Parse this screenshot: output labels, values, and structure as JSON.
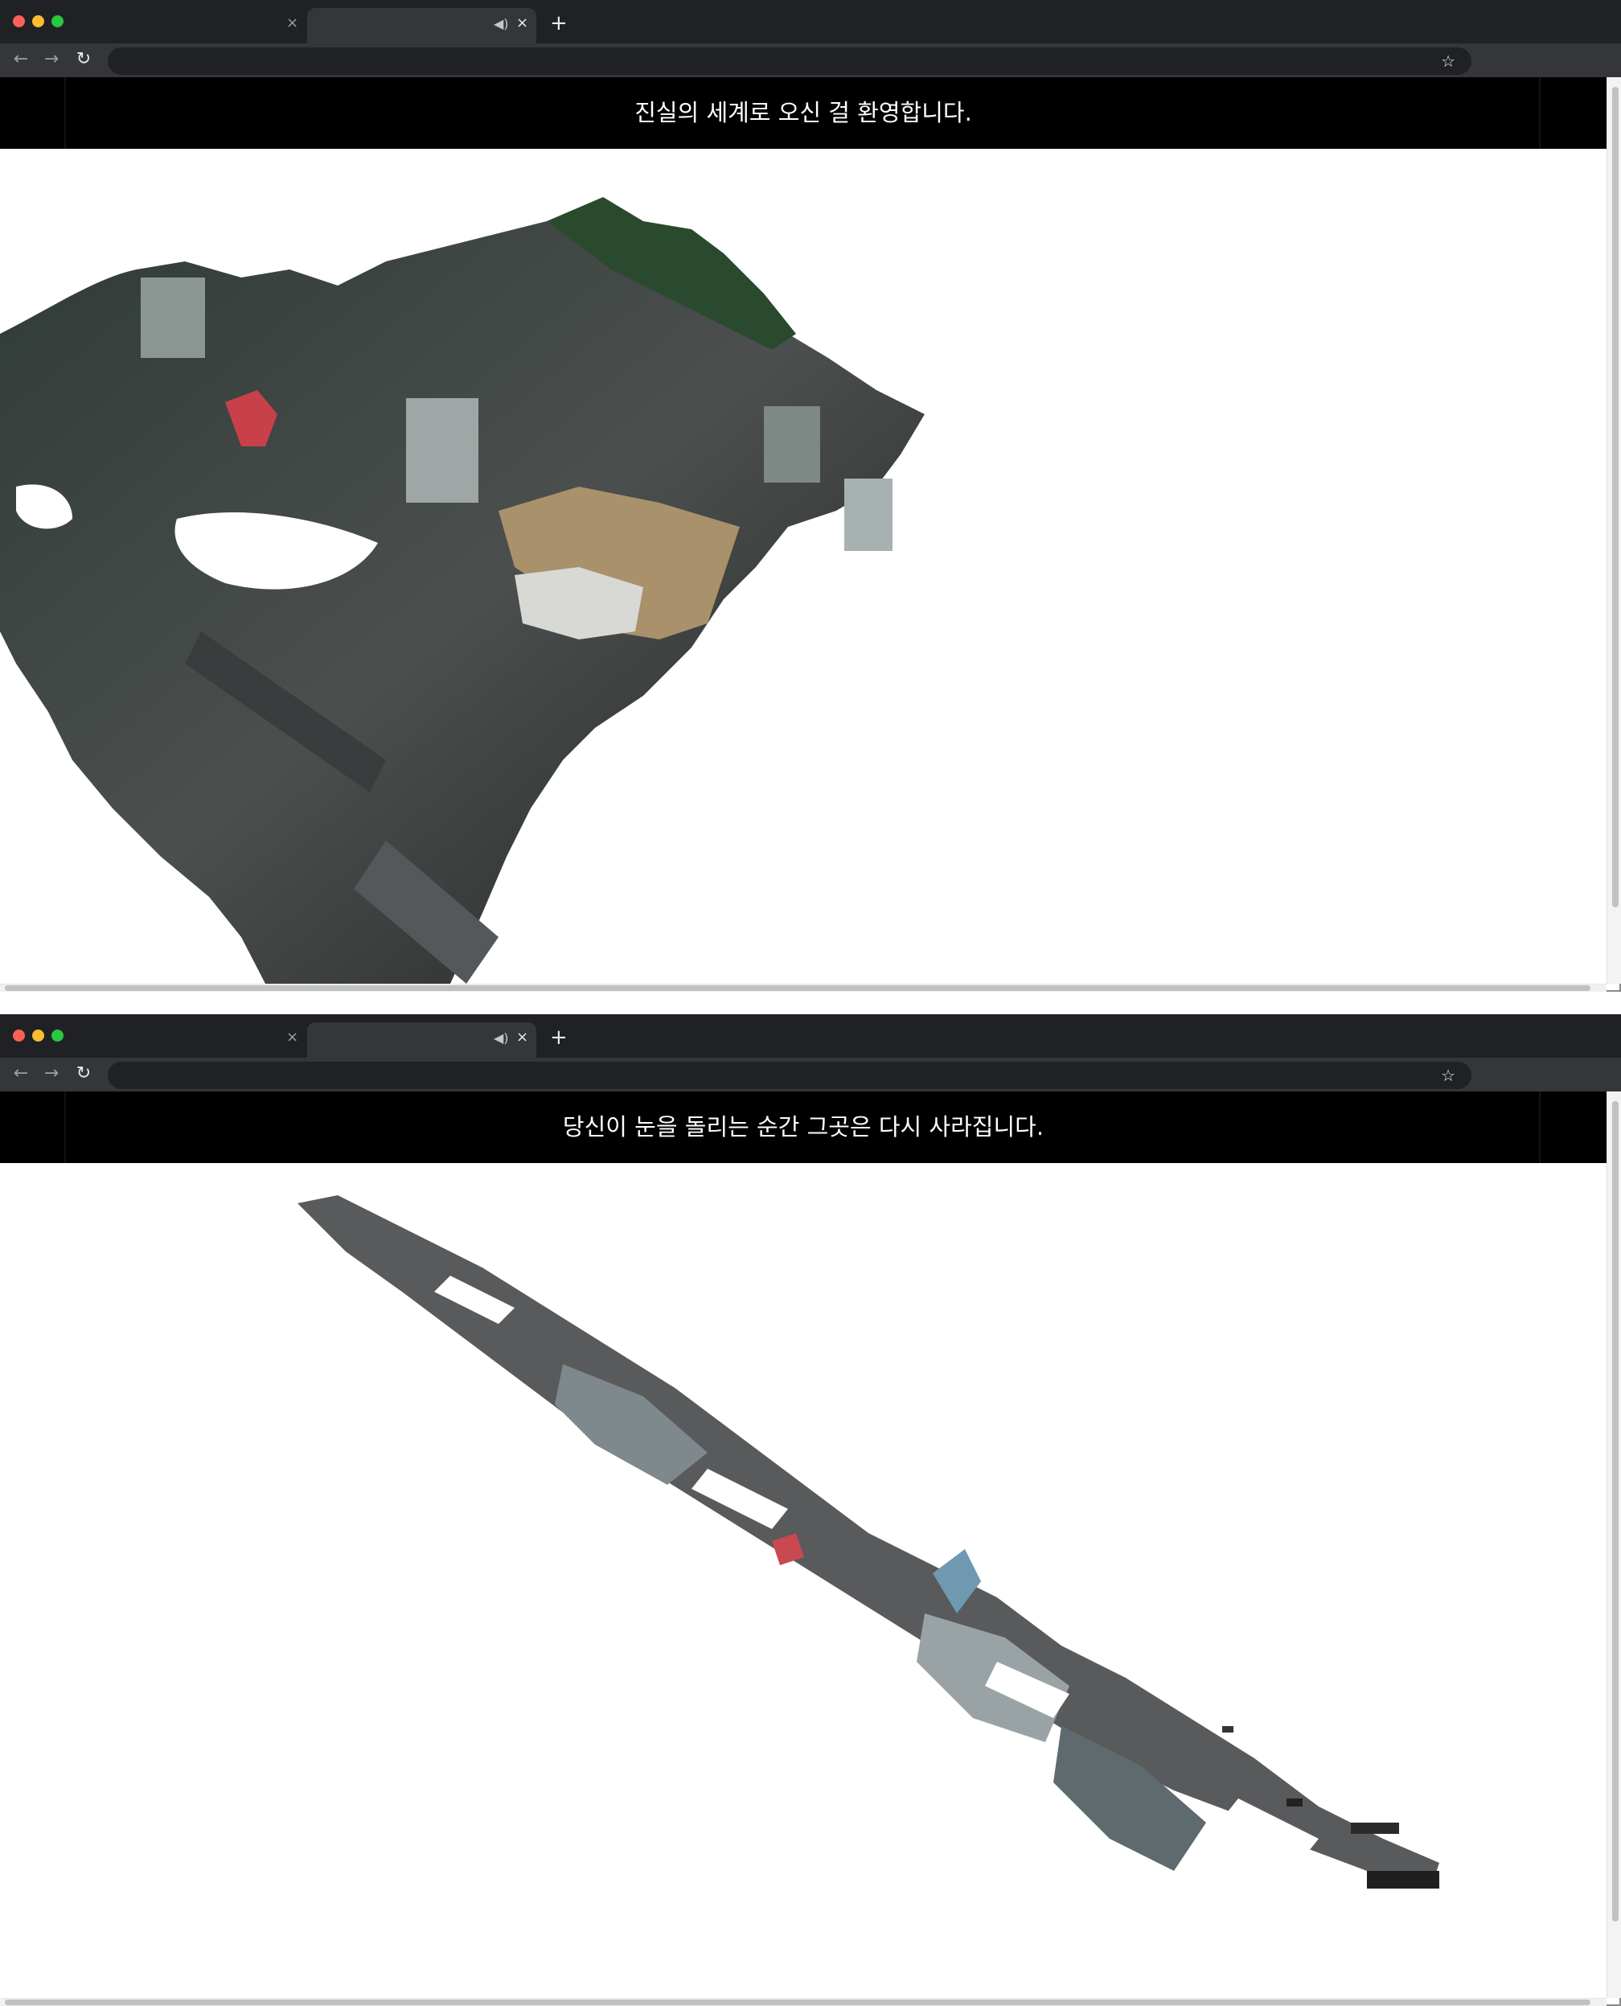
{
  "windows": [
    {
      "tab_active_mute_icon": "speaker-mute-icon",
      "header_text": "진실의 세계로 오신 걸 환영합니다.",
      "scene": "3d-city-mesh-full"
    },
    {
      "tab_active_mute_icon": "speaker-mute-icon",
      "header_text": "당신이 눈을 돌리는 순간 그곳은 다시 사라집니다.",
      "scene": "3d-city-mesh-fragmented"
    }
  ],
  "glyphs": {
    "close": "×",
    "mute": "🔇",
    "new_tab": "+",
    "back": "←",
    "forward": "→",
    "reload": "↻",
    "star": "☆"
  },
  "colors": {
    "tabbar": "#202124",
    "toolbar": "#35363a",
    "header": "#000000",
    "header_text": "#ffffff"
  }
}
